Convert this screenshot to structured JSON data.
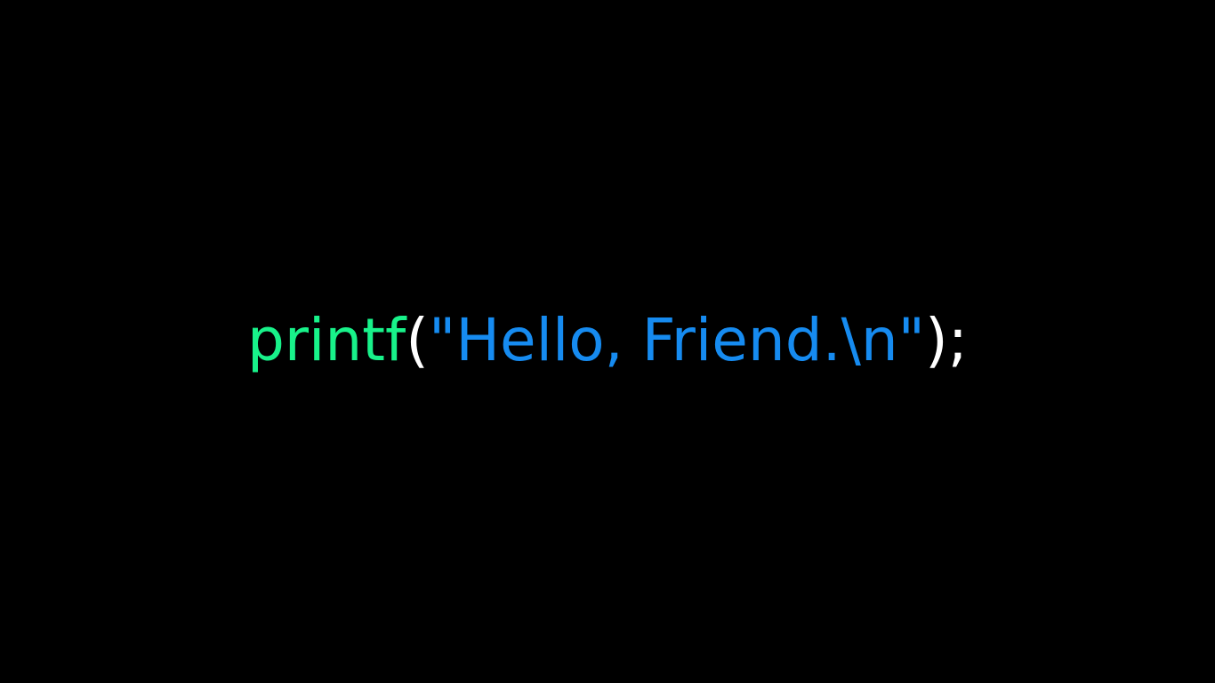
{
  "code": {
    "function_name": "printf",
    "open_paren": "(",
    "string_literal": "\"Hello, Friend.\\n\"",
    "close": ");"
  },
  "colors": {
    "background": "#000000",
    "function": "#18f28a",
    "punctuation": "#ffffff",
    "string": "#168bf0"
  }
}
